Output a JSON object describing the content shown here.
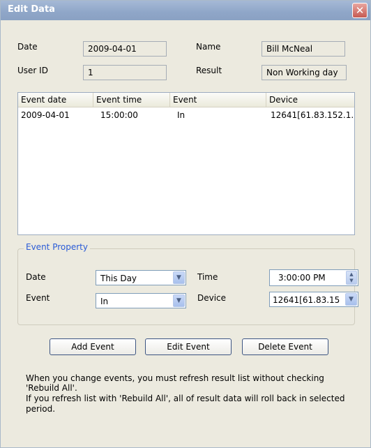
{
  "window": {
    "title": "Edit Data",
    "close_glyph": "✕"
  },
  "info": {
    "date_label": "Date",
    "date_value": "2009-04-01",
    "name_label": "Name",
    "name_value": "Bill McNeal",
    "userid_label": "User ID",
    "userid_value": "1",
    "result_label": "Result",
    "result_value": "Non Working day"
  },
  "events_table": {
    "columns": [
      "Event date",
      "Event time",
      "Event",
      "Device"
    ],
    "rows": [
      [
        "2009-04-01",
        "15:00:00",
        "In",
        "12641[61.83.152.1..."
      ]
    ]
  },
  "event_property": {
    "group_title": "Event Property",
    "date_label": "Date",
    "date_value": "This Day",
    "time_label": "Time",
    "time_value": "3:00:00 PM",
    "event_label": "Event",
    "event_value": "In",
    "device_label": "Device",
    "device_value": "12641[61.83.15"
  },
  "buttons": {
    "add": "Add Event",
    "edit": "Edit Event",
    "delete": "Delete Event"
  },
  "notes": [
    "When you change events, you must refresh result list without checking",
    "'Rebuild All'.",
    "If you refresh list with 'Rebuild All', all of result data will roll back in selected",
    "period."
  ],
  "icons": {
    "dropdown": "chevron-down-icon",
    "spin_up": "spin-up-icon",
    "spin_down": "spin-down-icon",
    "close": "close-icon"
  }
}
